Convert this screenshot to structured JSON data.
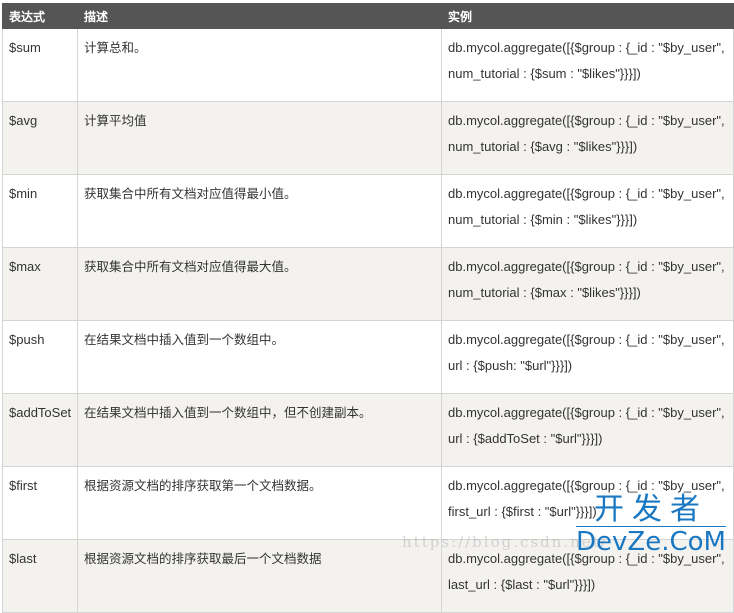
{
  "table": {
    "headers": [
      "表达式",
      "描述",
      "实例"
    ],
    "rows": [
      {
        "expr": "$sum",
        "desc": "计算总和。",
        "ex1": "db.mycol.aggregate([{$group : {_id : \"$by_user\",",
        "ex2": "num_tutorial : {$sum : \"$likes\"}}}])"
      },
      {
        "expr": "$avg",
        "desc": "计算平均值",
        "ex1": "db.mycol.aggregate([{$group : {_id : \"$by_user\",",
        "ex2": "num_tutorial : {$avg : \"$likes\"}}}])"
      },
      {
        "expr": "$min",
        "desc": "获取集合中所有文档对应值得最小值。",
        "ex1": "db.mycol.aggregate([{$group : {_id : \"$by_user\",",
        "ex2": "num_tutorial : {$min : \"$likes\"}}}])"
      },
      {
        "expr": "$max",
        "desc": "获取集合中所有文档对应值得最大值。",
        "ex1": "db.mycol.aggregate([{$group : {_id : \"$by_user\",",
        "ex2": "num_tutorial : {$max : \"$likes\"}}}])"
      },
      {
        "expr": "$push",
        "desc": "在结果文档中插入值到一个数组中。",
        "ex1": "db.mycol.aggregate([{$group : {_id : \"$by_user\",",
        "ex2": "url : {$push: \"$url\"}}}])"
      },
      {
        "expr": "$addToSet",
        "desc": "在结果文档中插入值到一个数组中，但不创建副本。",
        "ex1": "db.mycol.aggregate([{$group : {_id : \"$by_user\",",
        "ex2": "url : {$addToSet : \"$url\"}}}])"
      },
      {
        "expr": "$first",
        "desc": "根据资源文档的排序获取第一个文档数据。",
        "ex1": "db.mycol.aggregate([{$group : {_id : \"$by_user\",",
        "ex2": "first_url : {$first : \"$url\"}}}])"
      },
      {
        "expr": "$last",
        "desc": "根据资源文档的排序获取最后一个文档数据",
        "ex1": "db.mycol.aggregate([{$group : {_id : \"$by_user\",",
        "ex2": "last_url : {$last : \"$url\"}}}])"
      }
    ]
  },
  "watermark": {
    "url_text": "https://blog.csdn.net/",
    "logo_cn": "开发者",
    "logo_en": "DevZe.CoM"
  },
  "colors": {
    "header_bg": "#555555",
    "row_alt_bg": "#f3f2ef",
    "border": "#d4d4d4",
    "logo_blue": "#1a78c2"
  }
}
